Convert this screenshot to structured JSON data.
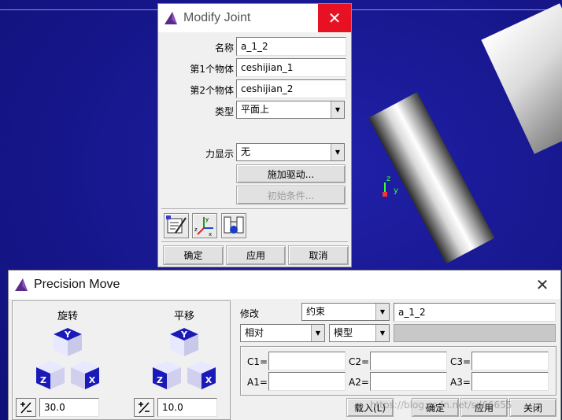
{
  "modify_joint": {
    "title": "Modify Joint",
    "close": "✕",
    "name_label": "名称",
    "name_value": "a_1_2",
    "body1_label": "第1个物体",
    "body1_value": "ceshijian_1",
    "body2_label": "第2个物体",
    "body2_value": "ceshijian_2",
    "type_label": "类型",
    "type_value": "平面上",
    "force_label": "力显示",
    "force_value": "无",
    "apply_motion": "施加驱动...",
    "initial_conditions": "初始条件...",
    "ok": "确定",
    "apply": "应用",
    "cancel": "取消"
  },
  "precision_move": {
    "title": "Precision Move",
    "close": "✕",
    "rotate_label": "旋转",
    "translate_label": "平移",
    "rotate_step": "30.0",
    "translate_step": "10.0",
    "modify_label": "修改",
    "target_type": "约束",
    "target_name": "a_1_2",
    "relative_mode": "相对",
    "ref_type": "模型",
    "c1_label": "C1=",
    "c2_label": "C2=",
    "c3_label": "C3=",
    "a1_label": "A1=",
    "a2_label": "A2=",
    "a3_label": "A3=",
    "load_button": "载入(L)",
    "ok_button": "确定",
    "apply_button": "应用",
    "close_button": "关闭",
    "cube_labels": {
      "y": "Y",
      "z": "Z",
      "x": "X"
    }
  },
  "viewport": {
    "axis_z": "z",
    "axis_y": "y",
    "watermark": "https://blog.csdn.net/sd66655"
  },
  "colors": {
    "viewport_bg": "#16168a",
    "close_red": "#e81123",
    "cube_blue": "#1a1ab8",
    "axis_green": "#39ff39"
  }
}
